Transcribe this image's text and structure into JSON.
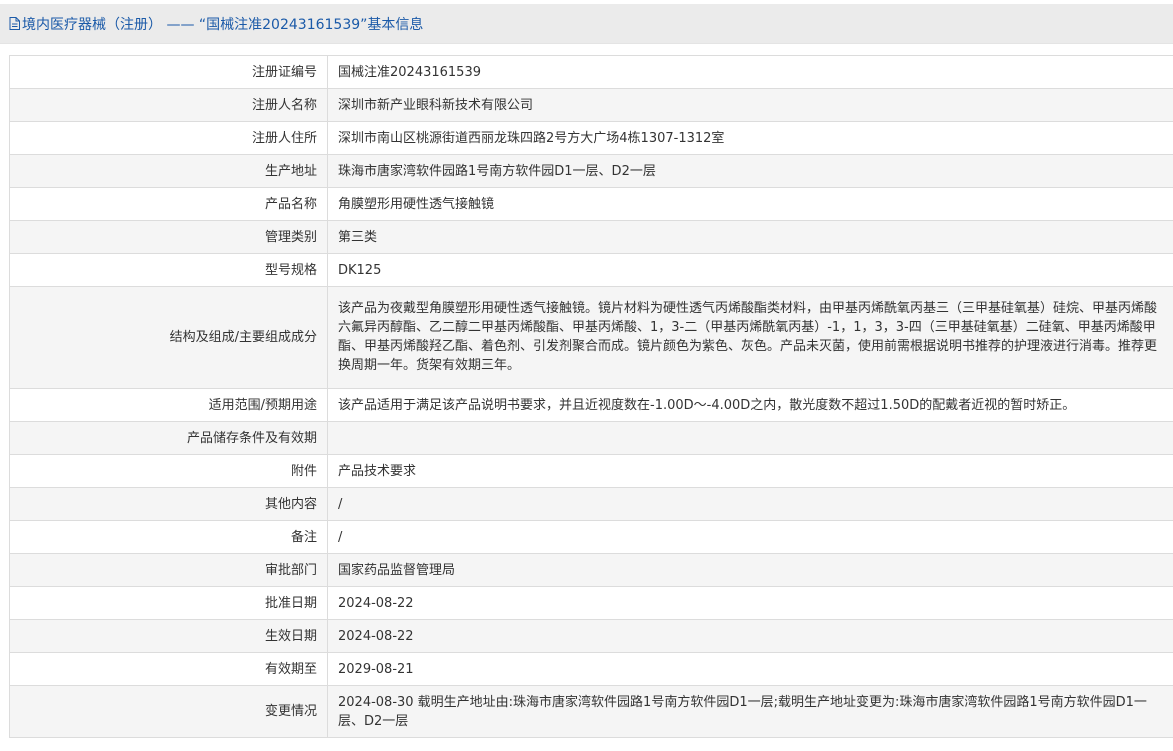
{
  "header": {
    "title": "境内医疗器械（注册） —— “国械注准20243161539”基本信息",
    "icon": "document-icon",
    "color": "#1b5aa8"
  },
  "rows": [
    {
      "label": "注册证编号",
      "value": "国械注准20243161539"
    },
    {
      "label": "注册人名称",
      "value": "深圳市新产业眼科新技术有限公司"
    },
    {
      "label": "注册人住所",
      "value": "深圳市南山区桃源街道西丽龙珠四路2号方大广场4栋1307-1312室"
    },
    {
      "label": "生产地址",
      "value": "珠海市唐家湾软件园路1号南方软件园D1一层、D2一层"
    },
    {
      "label": "产品名称",
      "value": "角膜塑形用硬性透气接触镜"
    },
    {
      "label": "管理类别",
      "value": "第三类"
    },
    {
      "label": "型号规格",
      "value": "DK125"
    },
    {
      "label": "结构及组成/主要组成成分",
      "value": "该产品为夜戴型角膜塑形用硬性透气接触镜。镜片材料为硬性透气丙烯酸酯类材料，由甲基丙烯酰氧丙基三（三甲基硅氧基）硅烷、甲基丙烯酸六氟异丙醇酯、乙二醇二甲基丙烯酸酯、甲基丙烯酸、1，3-二（甲基丙烯酰氧丙基）-1，1，3，3-四（三甲基硅氧基）二硅氧、甲基丙烯酸甲酯、甲基丙烯酸羟乙酯、着色剂、引发剂聚合而成。镜片颜色为紫色、灰色。产品未灭菌，使用前需根据说明书推荐的护理液进行消毒。推荐更换周期一年。货架有效期三年。"
    },
    {
      "label": "适用范围/预期用途",
      "value": "该产品适用于满足该产品说明书要求，并且近视度数在-1.00D～-4.00D之内，散光度数不超过1.50D的配戴者近视的暂时矫正。"
    },
    {
      "label": "产品储存条件及有效期",
      "value": ""
    },
    {
      "label": "附件",
      "value": "产品技术要求"
    },
    {
      "label": "其他内容",
      "value": "/"
    },
    {
      "label": "备注",
      "value": "/"
    },
    {
      "label": "审批部门",
      "value": "国家药品监督管理局"
    },
    {
      "label": "批准日期",
      "value": "2024-08-22"
    },
    {
      "label": "生效日期",
      "value": "2024-08-22"
    },
    {
      "label": "有效期至",
      "value": "2029-08-21"
    },
    {
      "label": "变更情况",
      "value": "2024-08-30 载明生产地址由:珠海市唐家湾软件园路1号南方软件园D1一层;载明生产地址变更为:珠海市唐家湾软件园路1号南方软件园D1一层、D2一层"
    }
  ]
}
